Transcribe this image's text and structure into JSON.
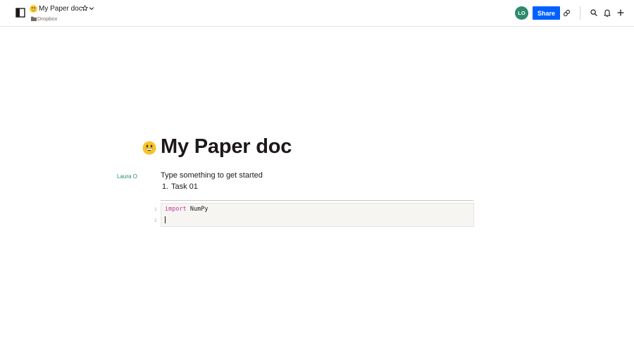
{
  "header": {
    "doc_title": "My Paper doc",
    "folder": "Dropbox",
    "avatar_initials": "LO",
    "share_label": "Share"
  },
  "document": {
    "emoji_icon": "grinning-face-icon",
    "title": "My Paper doc",
    "author": "Laura O",
    "paragraph": "Type something to get started",
    "list": [
      {
        "number": "1.",
        "text": "Task 01"
      }
    ],
    "code": {
      "lines": [
        {
          "number": "1",
          "keyword": "import",
          "rest": " NumPy"
        },
        {
          "number": "2",
          "keyword": "",
          "rest": ""
        }
      ]
    }
  },
  "icons": {
    "sidebar_toggle": "sidebar-toggle-icon",
    "star": "star-icon",
    "chevron": "chevron-down-icon",
    "folder": "folder-icon",
    "link": "link-icon",
    "search": "search-icon",
    "bell": "bell-icon",
    "plus": "plus-icon"
  },
  "colors": {
    "accent": "#0061fe",
    "author": "#2e8a6b",
    "avatar_bg": "#2e8a6b",
    "keyword": "#c2399a",
    "code_bg": "#f7f5f2"
  }
}
